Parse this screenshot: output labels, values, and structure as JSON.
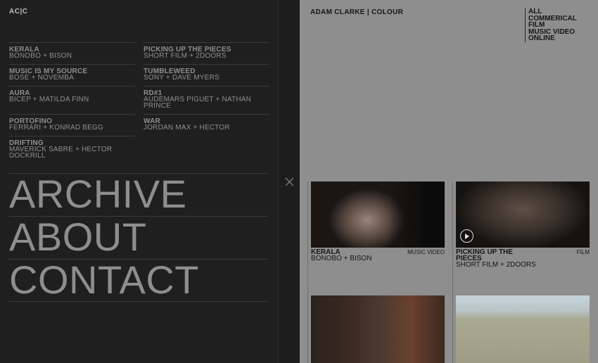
{
  "logo": "AC|C",
  "projects": [
    {
      "title": "KERALA",
      "subtitle": "BONOBO + BISON"
    },
    {
      "title": "PICKING UP THE PIECES",
      "subtitle": "SHORT FILM + 2DOORS"
    },
    {
      "title": "MUSIC IS MY SOURCE",
      "subtitle": "BOSE + NOVEMBA"
    },
    {
      "title": "TUMBLEWEED",
      "subtitle": "SONY + DAVE MYERS"
    },
    {
      "title": "AURA",
      "subtitle": "BICEP + MATILDA FINN"
    },
    {
      "title": "RD#1",
      "subtitle": "AUDEMARS PIGUET + NATHAN PRINCE"
    },
    {
      "title": "PORTOFINO",
      "subtitle": "FERRARI + KONRAD BEGG"
    },
    {
      "title": "WAR",
      "subtitle": "JORDAN MAX + HECTOR"
    },
    {
      "title": "DRIFTING",
      "subtitle": "MAVERICK SABRE + HECTOR DOCKRILL"
    }
  ],
  "nav": [
    "ARCHIVE",
    "ABOUT",
    "CONTACT"
  ],
  "brand": "ADAM CLARKE | COLOUR",
  "filters": [
    "ALL",
    "COMMERICAL",
    "FILM",
    "MUSIC VIDEO",
    "ONLINE"
  ],
  "cards": [
    {
      "title": "KERALA",
      "subtitle": "BONOBO + BISON",
      "tag": "MUSIC VIDEO"
    },
    {
      "title": "PICKING UP THE PIECES",
      "subtitle": "SHORT FILM + 2DOORS",
      "tag": "FILM"
    },
    {
      "title": "",
      "subtitle": "",
      "tag": ""
    },
    {
      "title": "",
      "subtitle": "",
      "tag": ""
    }
  ],
  "icons": {
    "close": "close-icon",
    "play": "play-icon"
  }
}
